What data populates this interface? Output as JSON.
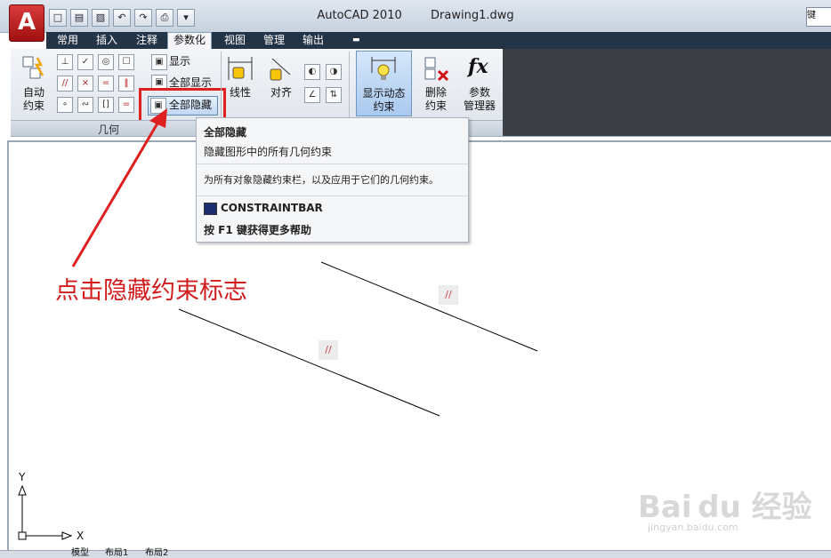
{
  "titlebar": {
    "app_title": "AutoCAD 2010",
    "document": "Drawing1.dwg",
    "logo_letter": "A",
    "search_placeholder": "键"
  },
  "tabs": [
    "常用",
    "插入",
    "注释",
    "参数化",
    "视图",
    "管理",
    "输出",
    "▬"
  ],
  "active_tab": "参数化",
  "ribbon": {
    "auto_constrain": [
      "自动",
      "约束"
    ],
    "show": "显示",
    "show_all": "全部显示",
    "hide_all": "全部隐藏",
    "geometric_panel": "几何",
    "linear": "线性",
    "aligned": "对齐",
    "show_dynamic": [
      "显示动态",
      "约束"
    ],
    "delete_constraints": [
      "删除",
      "约束"
    ],
    "param_manager": [
      "参数",
      "管理器"
    ],
    "fx_icon": "fx"
  },
  "tooltip": {
    "title": "全部隐藏",
    "summary": "隐藏图形中的所有几何约束",
    "description": "为所有对象隐藏约束栏，以及应用于它们的几何约束。",
    "command": "CONSTRAINTBAR",
    "help": "按 F1 键获得更多帮助"
  },
  "annotation": "点击隐藏约束标志",
  "canvas": {
    "ucs_x": "X",
    "ucs_y": "Y",
    "constraint_badge": "//"
  },
  "status_tabs": [
    "模型",
    "布局1",
    "布局2"
  ],
  "watermark": {
    "brand": "Bai du 经验",
    "url": "jingyan.baidu.com"
  },
  "colors": {
    "annotation": "#d01c1c",
    "highlight": "#e02020",
    "tab_bar": "#243447"
  }
}
